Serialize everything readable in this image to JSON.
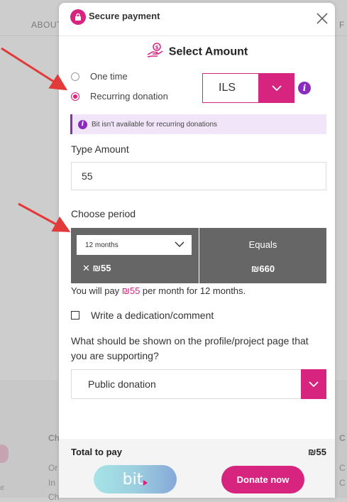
{
  "background": {
    "nav_left": "ABOUT",
    "nav_right": "F",
    "side_texts": [
      "Ch",
      "Or",
      "In",
      "Ch",
      "d"
    ],
    "right_texts": [
      "C",
      "C",
      "C"
    ]
  },
  "modal": {
    "header_title": "Secure payment",
    "icons": {
      "lock": "lock-icon",
      "close": "close-icon"
    },
    "section_title": "Select Amount",
    "donation_types": [
      {
        "label": "One time",
        "selected": false
      },
      {
        "label": "Recurring donation",
        "selected": true
      }
    ],
    "currency": {
      "value": "ILS"
    },
    "notice": "Bit isn't available for recurring donations",
    "amount": {
      "label": "Type Amount",
      "value": "55"
    },
    "period": {
      "label": "Choose period",
      "selected": "12 months",
      "multiplier": "✕ ₪55",
      "equals_label": "Equals",
      "equals_value": "₪660"
    },
    "pay_summary": {
      "prefix": "You will pay ",
      "amount": "₪55",
      "suffix": " per month for 12 months."
    },
    "dedication": {
      "label": "Write a dedication/comment",
      "checked": false
    },
    "visibility": {
      "question": "What should be shown on the profile/project page that you are supporting?",
      "selected": "Public donation"
    },
    "footer": {
      "total_label": "Total to pay",
      "total_value": "₪55",
      "bit_label": "bit",
      "donate_label": "Donate now"
    }
  },
  "colors": {
    "accent": "#d6247f",
    "info": "#8a2bbf",
    "arrow": "#e23a3a"
  }
}
